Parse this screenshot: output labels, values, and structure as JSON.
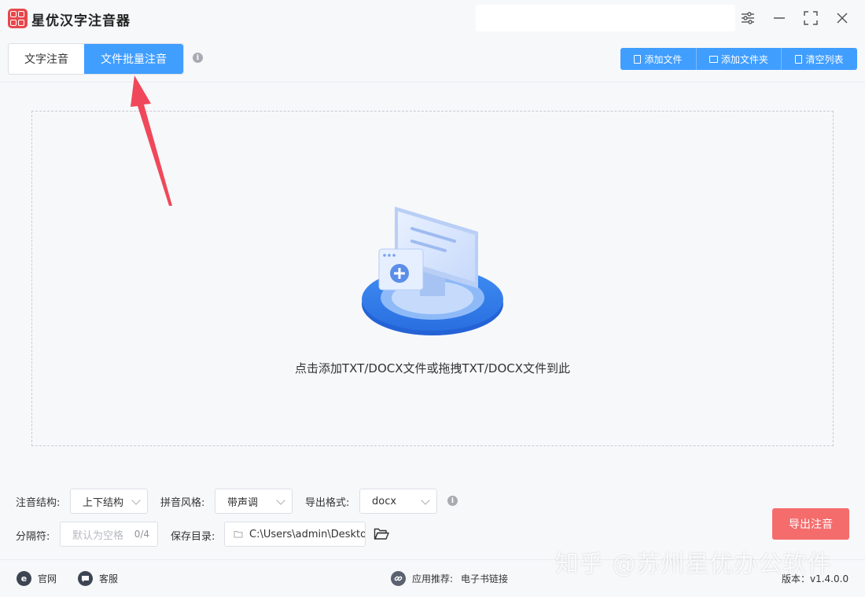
{
  "app": {
    "title": "星优汉字注音器"
  },
  "tabs": [
    {
      "label": "文字注音",
      "active": false
    },
    {
      "label": "文件批量注音",
      "active": true
    }
  ],
  "toolbar": {
    "add_file": "添加文件",
    "add_folder": "添加文件夹",
    "clear_list": "清空列表"
  },
  "dropzone": {
    "hint": "点击添加TXT/DOCX文件或拖拽TXT/DOCX文件到此"
  },
  "settings": {
    "structure_label": "注音结构:",
    "structure_value": "上下结构",
    "style_label": "拼音风格:",
    "style_value": "带声调",
    "format_label": "导出格式:",
    "format_value": "docx",
    "separator_label": "分隔符:",
    "separator_placeholder": "默认为空格",
    "separator_count": "0/4",
    "save_label": "保存目录:",
    "save_path": "C:\\Users\\admin\\Deskto"
  },
  "actions": {
    "export": "导出注音"
  },
  "footer": {
    "website": "官网",
    "support": "客服",
    "recommend_label": "应用推荐:",
    "recommend_app": "电子书链接",
    "version": "版本：v1.4.0.0"
  },
  "watermark": "知乎 @苏州星优办公软件",
  "colors": {
    "primary": "#409eff",
    "danger": "#f56c6c",
    "logo": "#e6484d",
    "arrow": "#f0485a"
  }
}
